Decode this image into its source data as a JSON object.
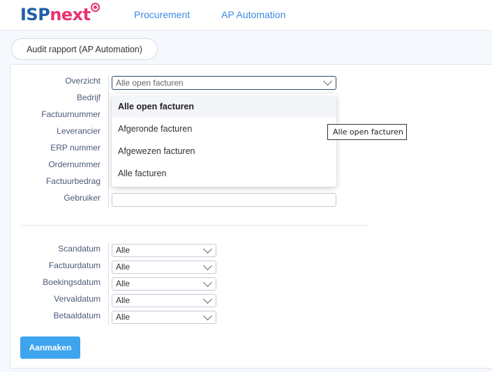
{
  "header": {
    "logo_isp": "ISP",
    "logo_next": "next",
    "nav": [
      "Procurement",
      "AP Automation"
    ]
  },
  "tab": {
    "label": "Audit rapport (AP Automation)"
  },
  "form": {
    "fields": [
      {
        "label": "Overzicht"
      },
      {
        "label": "Bedrijf"
      },
      {
        "label": "Factuurnummer"
      },
      {
        "label": "Leverancier"
      },
      {
        "label": "ERP nummer"
      },
      {
        "label": "Ordernummer"
      },
      {
        "label": "Factuurbedrag"
      },
      {
        "label": "Gebruiker"
      }
    ],
    "overzicht_value": "Alle open facturen",
    "overzicht_options": [
      "Alle open facturen",
      "Afgeronde facturen",
      "Afgewezen facturen",
      "Alle facturen"
    ],
    "tooltip": "Alle open facturen",
    "dates": [
      {
        "label": "Scandatum",
        "value": "Alle"
      },
      {
        "label": "Factuurdatum",
        "value": "Alle"
      },
      {
        "label": "Boekingsdatum",
        "value": "Alle"
      },
      {
        "label": "Vervaldatum",
        "value": "Alle"
      },
      {
        "label": "Betaaldatum",
        "value": "Alle"
      }
    ],
    "submit_label": "Aanmaken"
  },
  "colors": {
    "brand_blue": "#1f5fa8",
    "brand_pink": "#e8336f",
    "nav_blue": "#3b8be0",
    "button_blue": "#3fa4ee"
  }
}
